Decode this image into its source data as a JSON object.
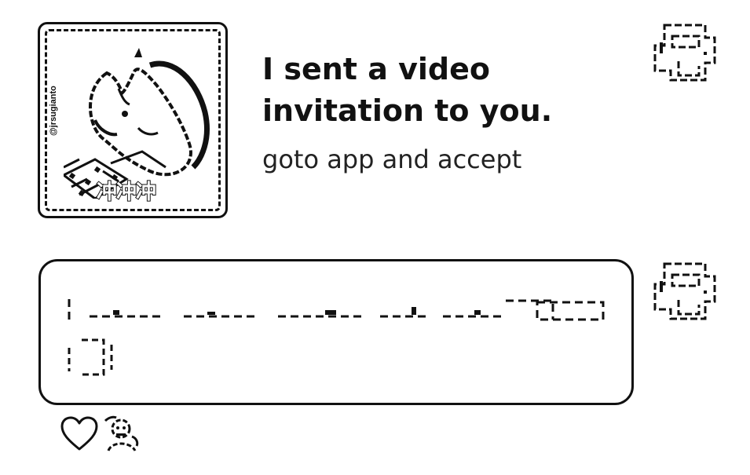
{
  "invitation": {
    "thumbnail_credit": "@jrsugianto",
    "thumbnail_caption": "冲冲冲",
    "title": "I sent a video invitation to you.",
    "subtitle": "goto app and accept"
  },
  "colors": {
    "ink": "#111111",
    "background": "#ffffff"
  },
  "icons": {
    "like": "heart-outline-icon",
    "reactor": "reactor-avatar-icon"
  }
}
